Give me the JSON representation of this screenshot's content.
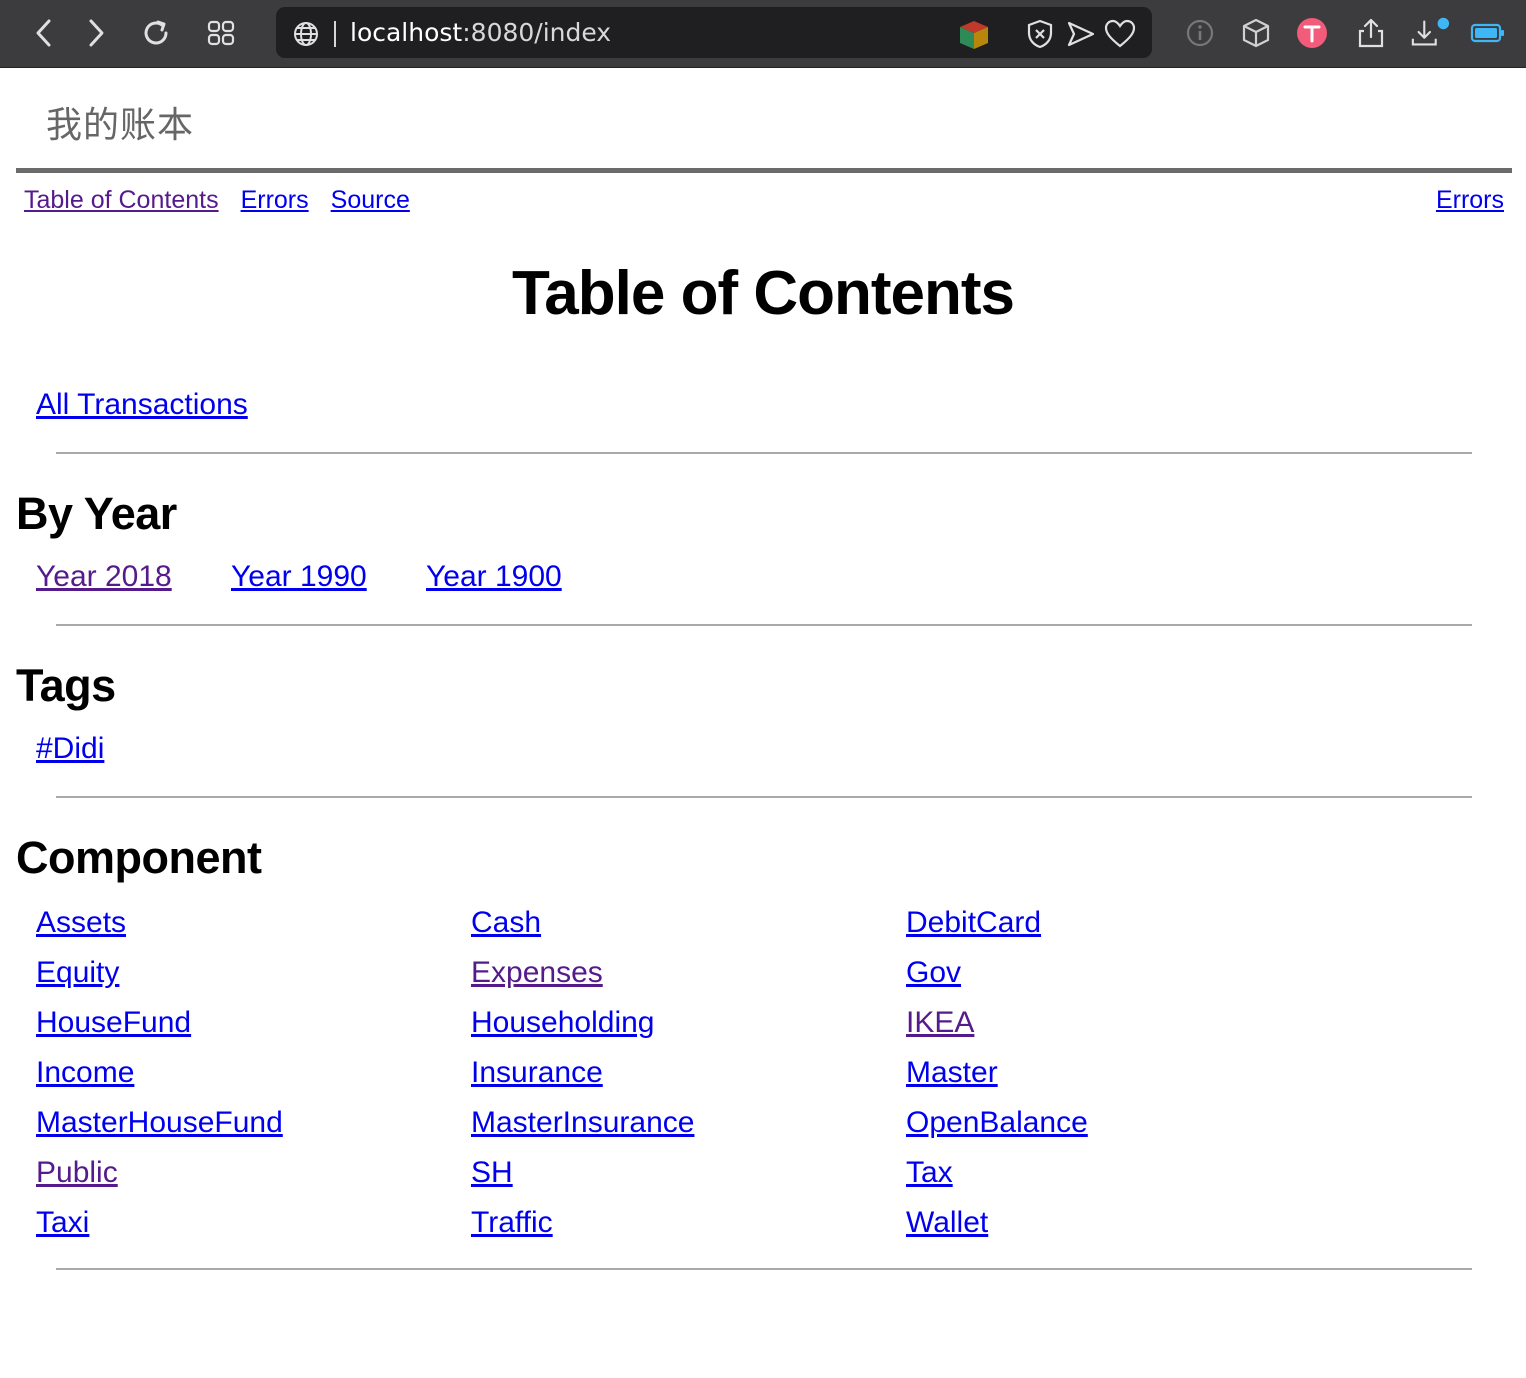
{
  "browser": {
    "url_host": "localhost",
    "url_path": ":8080/index"
  },
  "site": {
    "title": "我的账本"
  },
  "nav": {
    "left": [
      {
        "label": "Table of Contents",
        "visited": true
      },
      {
        "label": "Errors",
        "visited": false
      },
      {
        "label": "Source",
        "visited": false
      }
    ],
    "right_label": "Errors"
  },
  "page": {
    "heading": "Table of Contents",
    "all_transactions": "All Transactions"
  },
  "by_year": {
    "heading": "By Year",
    "years": [
      {
        "label": "Year 2018",
        "visited": true
      },
      {
        "label": "Year 1990",
        "visited": false
      },
      {
        "label": "Year 1900",
        "visited": false
      }
    ]
  },
  "tags": {
    "heading": "Tags",
    "items": [
      {
        "label": "#Didi",
        "visited": false
      }
    ]
  },
  "component": {
    "heading": "Component",
    "items": [
      {
        "label": "Assets",
        "visited": false
      },
      {
        "label": "Cash",
        "visited": false
      },
      {
        "label": "DebitCard",
        "visited": false
      },
      {
        "label": "Equity",
        "visited": false
      },
      {
        "label": "Expenses",
        "visited": true
      },
      {
        "label": "Gov",
        "visited": false
      },
      {
        "label": "HouseFund",
        "visited": false
      },
      {
        "label": "Householding",
        "visited": false
      },
      {
        "label": "IKEA",
        "visited": true
      },
      {
        "label": "Income",
        "visited": false
      },
      {
        "label": "Insurance",
        "visited": false
      },
      {
        "label": "Master",
        "visited": false
      },
      {
        "label": "MasterHouseFund",
        "visited": false
      },
      {
        "label": "MasterInsurance",
        "visited": false
      },
      {
        "label": "OpenBalance",
        "visited": false
      },
      {
        "label": "Public",
        "visited": true
      },
      {
        "label": "SH",
        "visited": false
      },
      {
        "label": "Tax",
        "visited": false
      },
      {
        "label": "Taxi",
        "visited": false
      },
      {
        "label": "Traffic",
        "visited": false
      },
      {
        "label": "Wallet",
        "visited": false
      }
    ]
  },
  "colors": {
    "link": "#0000ee",
    "visited": "#551a8b",
    "toolbar": "#3c3c3e",
    "rule": "#6b6b6b"
  }
}
